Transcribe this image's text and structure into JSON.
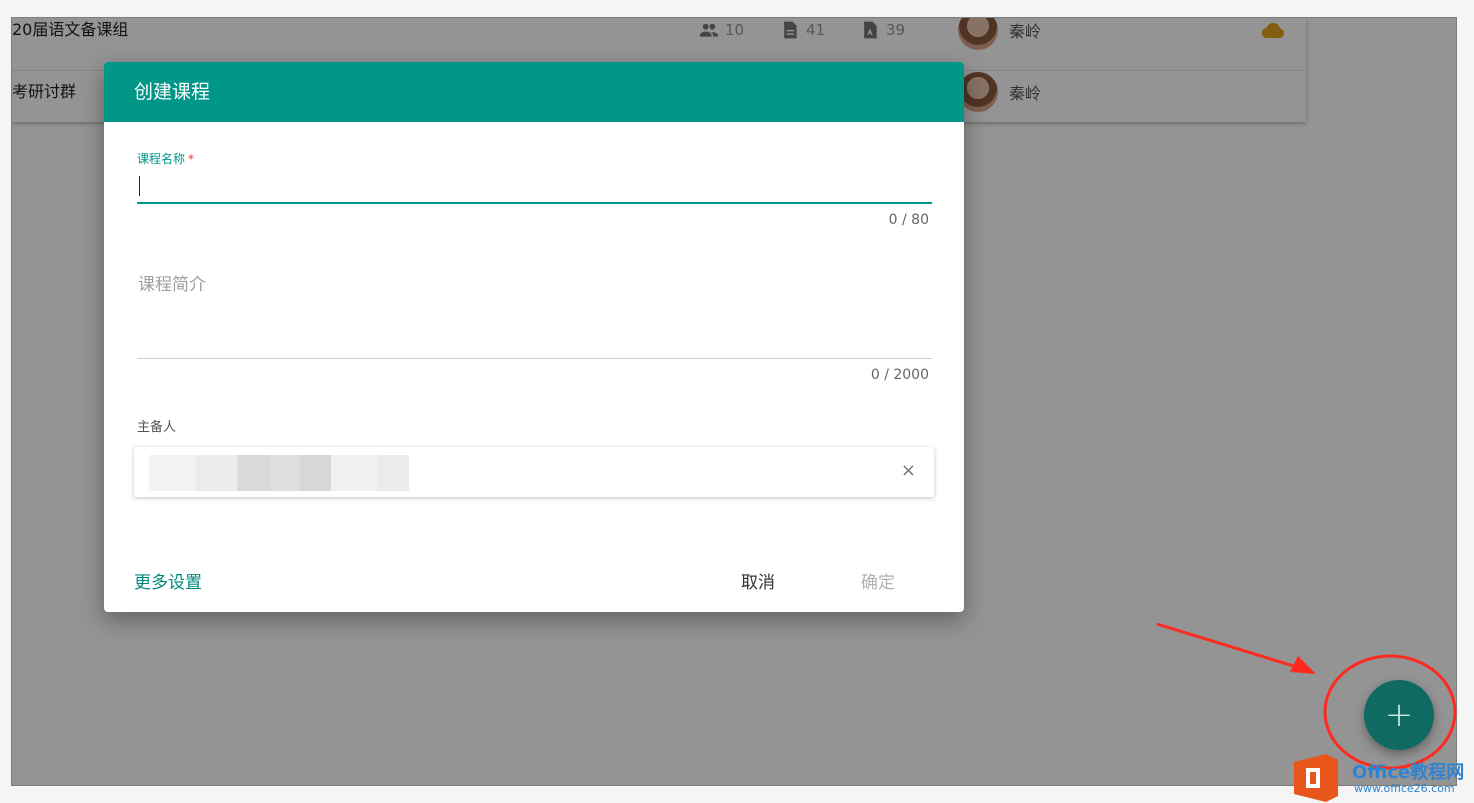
{
  "list": {
    "rows": [
      {
        "name": "20届语文备课组",
        "members": "10",
        "docs": "41",
        "tests": "39",
        "owner": "秦岭"
      },
      {
        "name": "考研讨群",
        "owner": "秦岭"
      }
    ]
  },
  "dialog": {
    "title": "创建课程",
    "course_name_label": "课程名称",
    "required_mark": "*",
    "course_name_counter": "0 / 80",
    "intro_placeholder": "课程简介",
    "intro_counter": "0 / 2000",
    "host_label": "主备人",
    "chip_remove": "×",
    "more_settings": "更多设置",
    "cancel": "取消",
    "confirm": "确定"
  },
  "fab": {
    "icon": "plus-icon",
    "symbol": "+"
  },
  "watermark": {
    "line1": "Office教程网",
    "line2": "www.office26.com"
  },
  "colors": {
    "primary": "#009688",
    "annotation": "#ff2a1f",
    "cloud": "#e0a21d"
  }
}
